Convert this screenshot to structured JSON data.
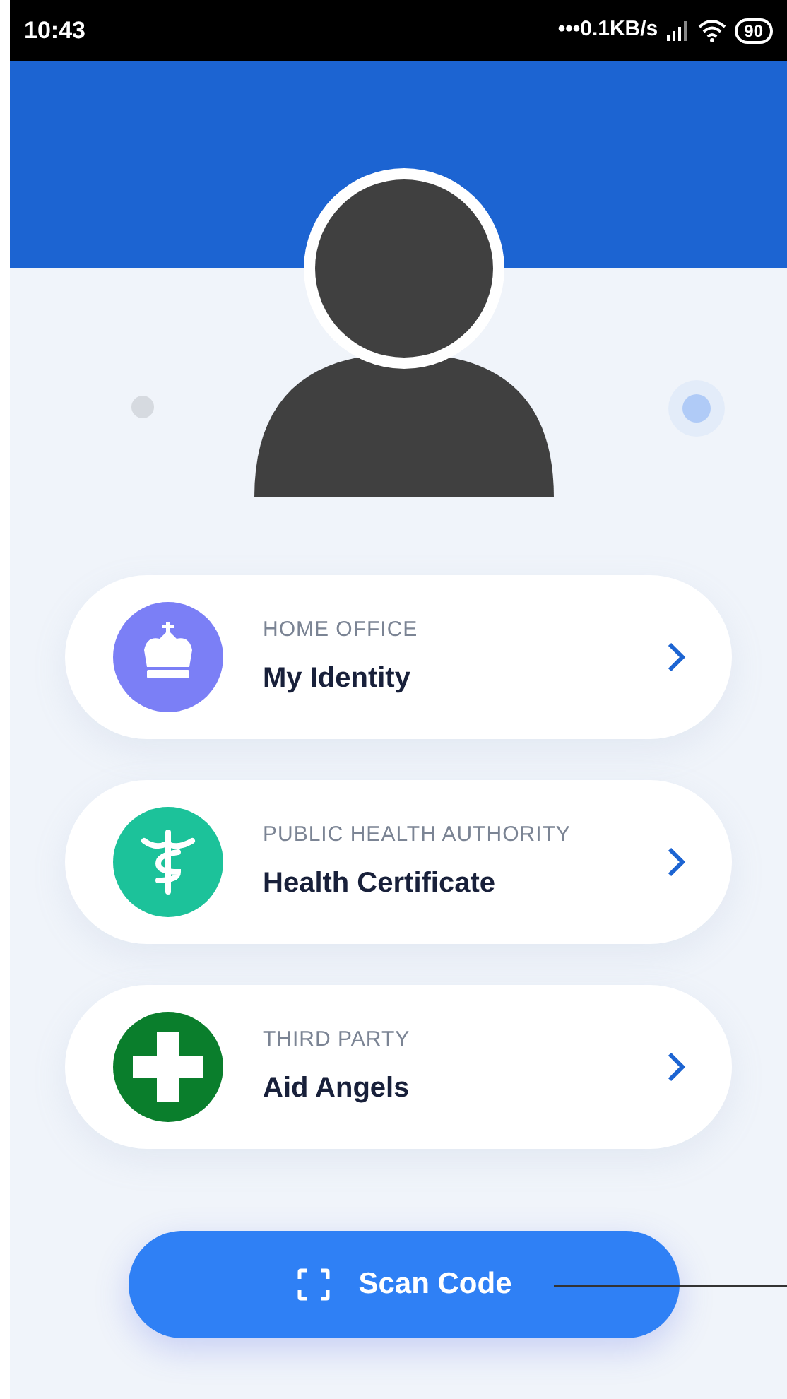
{
  "status_bar": {
    "time": "10:43",
    "network_speed": "•••0.1KB/s",
    "battery": "90"
  },
  "cards": [
    {
      "kind": "crown",
      "issuer": "HOME OFFICE",
      "title": "My Identity",
      "color": "#7b7ff6"
    },
    {
      "kind": "caduceus",
      "issuer": "PUBLIC HEALTH AUTHORITY",
      "title": "Health Certificate",
      "color": "#1cc29a"
    },
    {
      "kind": "cross",
      "issuer": "THIRD PARTY",
      "title": "Aid Angels",
      "color": "#0a7e2c"
    }
  ],
  "scan_button": {
    "label": "Scan Code"
  }
}
